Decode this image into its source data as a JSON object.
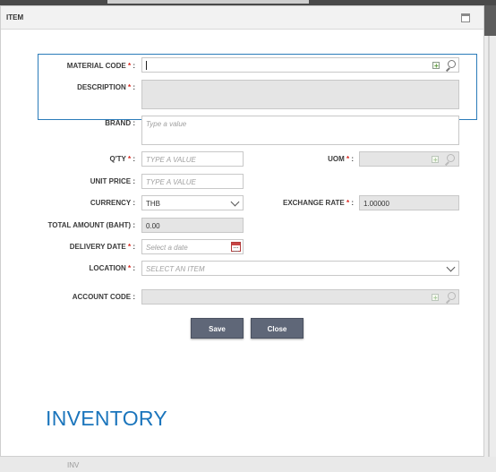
{
  "dialog": {
    "title": "ITEM",
    "watermark": "INVENTORY",
    "background_hint": "INV"
  },
  "form": {
    "material_code": {
      "label": "MATERIAL CODE",
      "value": ""
    },
    "description": {
      "label": "DESCRIPTION",
      "value": ""
    },
    "brand": {
      "label": "BRAND",
      "placeholder": "Type a value"
    },
    "qty": {
      "label": "Q'TY",
      "placeholder": "TYPE A VALUE"
    },
    "uom": {
      "label": "UOM",
      "value": ""
    },
    "unit_price": {
      "label": "UNIT PRICE",
      "placeholder": "TYPE A VALUE"
    },
    "currency": {
      "label": "CURRENCY",
      "value": "THB"
    },
    "exchange_rate": {
      "label": "EXCHANGE RATE",
      "value": "1.00000"
    },
    "total_amount": {
      "label": "TOTAL AMOUNT (BAHT)",
      "value": "0.00"
    },
    "delivery_date": {
      "label": "DELIVERY DATE",
      "placeholder": "Select a date"
    },
    "location": {
      "label": "LOCATION",
      "placeholder": "SELECT AN ITEM"
    },
    "account_code": {
      "label": "ACCOUNT CODE",
      "value": ""
    },
    "required_mark": "*",
    "colon": ":"
  },
  "buttons": {
    "save": "Save",
    "close": "Close"
  },
  "colors": {
    "accent": "#2b7bb9",
    "required": "#d9241c",
    "button": "#5f6778",
    "brand_text": "#1b75bc"
  }
}
